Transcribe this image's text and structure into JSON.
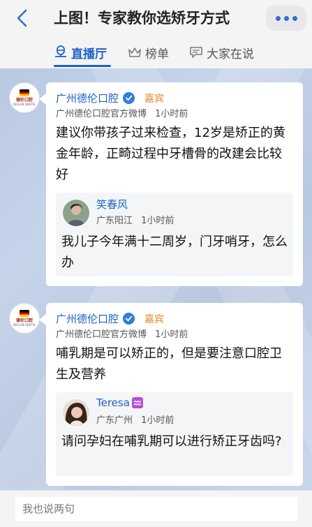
{
  "header": {
    "title": "上图！专家教你选矫牙方式",
    "back_icon": "chevron-left-icon",
    "more_icon": "more-dots-icon",
    "accent": "#2f6fcd"
  },
  "tabs": [
    {
      "label": "直播厅",
      "icon": "live-mic-icon",
      "active": true
    },
    {
      "label": "榜单",
      "icon": "crown-icon",
      "active": false
    },
    {
      "label": "大家在说",
      "icon": "chat-icon",
      "active": false
    }
  ],
  "posts": [
    {
      "author": "广州德伦口腔",
      "role": "嘉宾",
      "source": "广州德伦口腔官方微博",
      "time": "1小时前",
      "avatar_text": "德伦口腔",
      "avatar_sub": "DEELUN DENTAL",
      "content": "建议你带孩子过来检查，12岁是矫正的黄金年龄，正畸过程中牙槽骨的改建会比较好",
      "reply": {
        "author": "笑春风",
        "location": "广东阳江",
        "time": "1小时前",
        "content": "我儿子今年满十二周岁，门牙哨牙，怎么办"
      }
    },
    {
      "author": "广州德伦口腔",
      "role": "嘉宾",
      "source": "广州德伦口腔官方微博",
      "time": "1小时前",
      "avatar_text": "德伦口腔",
      "avatar_sub": "DEELUN DENTAL",
      "content": "哺乳期是可以矫正的，但是要注意口腔卫生及营养",
      "reply": {
        "author": "Teresa",
        "location": "广东广州",
        "time": "1小时前",
        "content": "请问孕妇在哺乳期可以进行矫正牙齿吗?"
      }
    }
  ],
  "comment_input": {
    "placeholder": "我也说两句"
  },
  "colors": {
    "link_blue": "#1d62c4",
    "guest_orange": "#e8862a",
    "verified_blue": "#2f7de1"
  }
}
